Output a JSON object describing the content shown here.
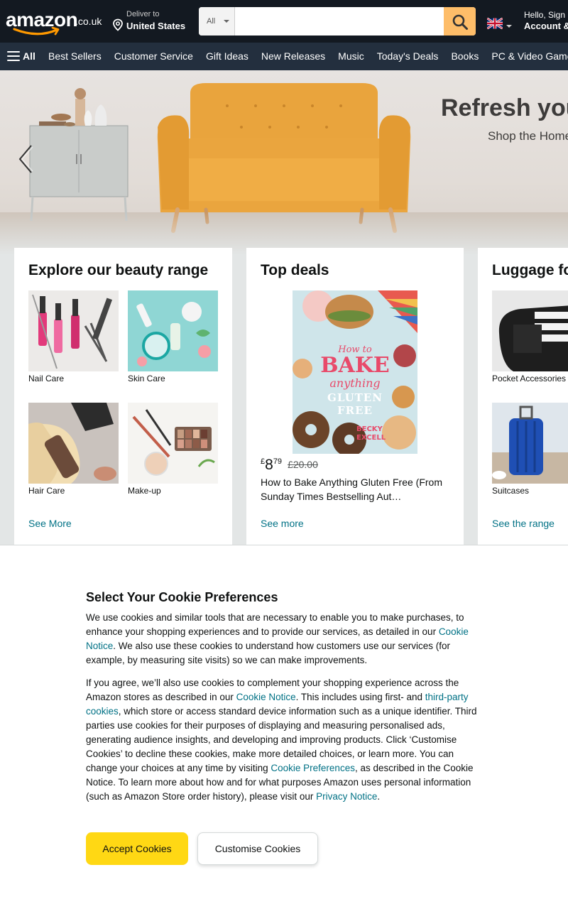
{
  "header": {
    "logo_wordmark": "amazon",
    "logo_tld": ".co.uk",
    "deliver_line1": "Deliver to",
    "deliver_line2": "United States",
    "search_category": "All",
    "search_placeholder": "",
    "account_line1": "Hello, Sign in",
    "account_line2": "Account & Lists"
  },
  "nav": {
    "all_label": "All",
    "links": [
      "Best Sellers",
      "Customer Service",
      "Gift Ideas",
      "New Releases",
      "Music",
      "Today's Deals",
      "Books",
      "PC & Video Games"
    ]
  },
  "hero": {
    "title": "Refresh your",
    "subtitle": "Shop the Home"
  },
  "cards": {
    "beauty": {
      "title": "Explore our beauty range",
      "tiles": [
        "Nail Care",
        "Skin Care",
        "Hair Care",
        "Make-up"
      ],
      "link": "See More"
    },
    "deals": {
      "title": "Top deals",
      "price_currency": "£",
      "price_whole": "8",
      "price_fraction": "79",
      "price_was": "£20.00",
      "product_title": "How to Bake Anything Gluten Free (From Sunday Times Bestselling Aut…",
      "link": "See more",
      "book_cover": {
        "line1": "How to",
        "line2": "BAKE",
        "line3": "anything",
        "line4": "GLUTEN",
        "line5": "FREE",
        "author": "BECKY EXCELL"
      }
    },
    "luggage": {
      "title": "Luggage fo",
      "tiles": [
        "Pocket Accessories",
        "Suitcases"
      ],
      "link": "See the range"
    }
  },
  "cookie": {
    "title": "Select Your Cookie Preferences",
    "p1_a": "We use cookies and similar tools that are necessary to enable you to make purchases, to enhance your shopping experiences and to provide our services, as detailed in our ",
    "p1_link": "Cookie Notice",
    "p1_b": ". We also use these cookies to understand how customers use our services (for example, by measuring site visits) so we can make improvements.",
    "p2_a": "If you agree, we’ll also use cookies to complement your shopping experience across the Amazon stores as described in our ",
    "p2_link1": "Cookie Notice",
    "p2_b": ". This includes using first- and ",
    "p2_link2": "third-party cookies",
    "p2_c": ", which store or access standard device information such as a unique identifier. Third parties use cookies for their purposes of displaying and measuring personalised ads, generating audience insights, and developing and improving products. Click ‘Customise Cookies’ to decline these cookies, make more detailed choices, or learn more. You can change your choices at any time by visiting ",
    "p2_link3": "Cookie Preferences",
    "p2_d": ", as described in the Cookie Notice. To learn more about how and for what purposes Amazon uses personal information (such as Amazon Store order history), please visit our ",
    "p2_link4": "Privacy Notice",
    "p2_e": ".",
    "accept_label": "Accept Cookies",
    "customise_label": "Customise Cookies"
  },
  "colors": {
    "header_bg": "#131921",
    "nav_bg": "#232f3e",
    "search_button": "#febd69",
    "accept_button": "#ffd814",
    "link": "#007185",
    "logo_smile": "#ff9900"
  },
  "icons": {
    "location": "map-pin-icon",
    "search": "magnifier-icon",
    "menu": "hamburger-icon",
    "flag": "uk-flag-icon",
    "carousel_prev": "chevron-left-icon"
  }
}
